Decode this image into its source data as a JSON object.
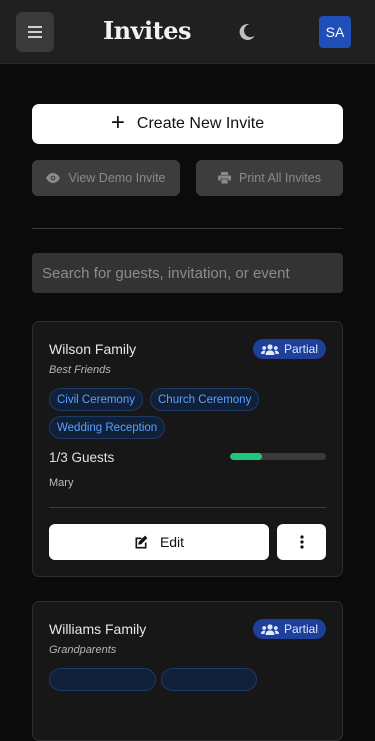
{
  "header": {
    "title": "Invites",
    "avatar_initials": "SA",
    "menu_icon": "hamburger-icon",
    "theme_icon": "moon-icon"
  },
  "actions": {
    "create_label": "Create New Invite",
    "demo_label": "View Demo Invite",
    "print_label": "Print All Invites"
  },
  "search": {
    "placeholder": "Search for guests, invitation, or event"
  },
  "invites": [
    {
      "name": "Wilson Family",
      "relation": "Best Friends",
      "status": "Partial",
      "events": [
        "Civil Ceremony",
        "Church Ceremony",
        "Wedding Reception"
      ],
      "guests_label": "1/3 Guests",
      "guests_progress": 0.33,
      "guest_names": "Mary",
      "edit_label": "Edit"
    },
    {
      "name": "Williams Family",
      "relation": "Grandparents",
      "status": "Partial",
      "events": [
        "",
        ""
      ]
    }
  ],
  "colors": {
    "accent": "#1e3f9a",
    "progress": "#1fc77e",
    "tag_text": "#5aa0ff"
  }
}
